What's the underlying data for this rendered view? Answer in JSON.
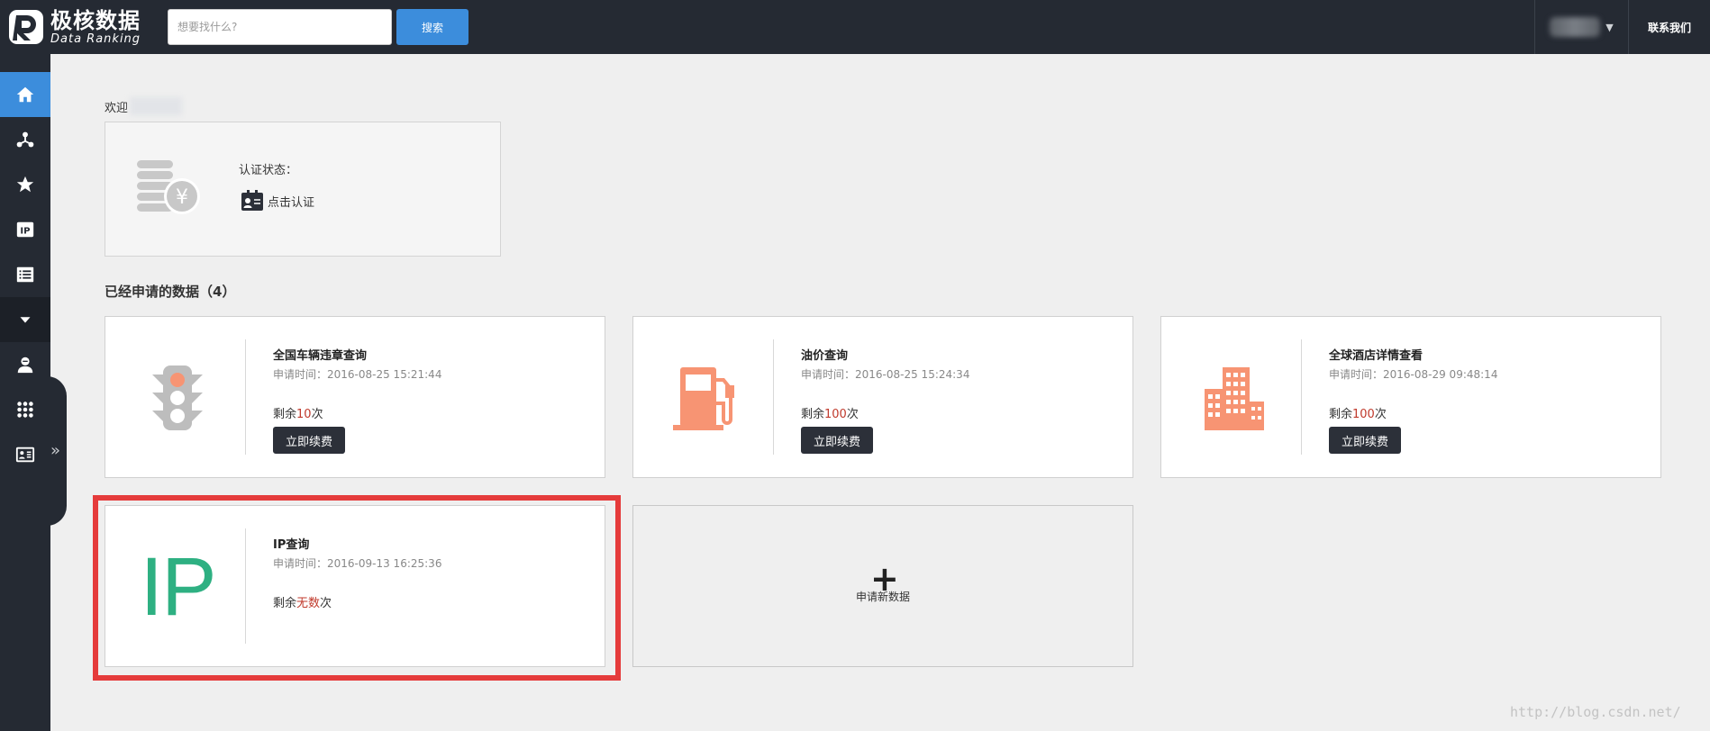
{
  "header": {
    "logo_cn": "极核数据",
    "logo_en": "Data Ranking",
    "search_placeholder": "想要找什么?",
    "search_button": "搜索",
    "contact": "联系我们"
  },
  "sidebar": {
    "items": [
      {
        "icon": "home-icon",
        "active": true
      },
      {
        "icon": "network-icon"
      },
      {
        "icon": "star-icon"
      },
      {
        "icon": "ip-icon",
        "label": "IP"
      },
      {
        "icon": "list-icon"
      },
      {
        "icon": "caret-down-icon"
      },
      {
        "icon": "user-icon"
      },
      {
        "icon": "apps-grid-icon"
      },
      {
        "icon": "id-card-icon"
      }
    ],
    "expand_label": "»"
  },
  "welcome": {
    "prefix": "欢迎"
  },
  "auth": {
    "title": "认证状态：",
    "link": "点击认证"
  },
  "section": {
    "title": "已经申请的数据（4）"
  },
  "cards": [
    {
      "name": "全国车辆违章查询",
      "time": "申请时间：2016-08-25 15:21:44",
      "remain_prefix": "剩余",
      "remain_num": "10",
      "remain_suffix": "次",
      "button": "立即续费",
      "icon": "traffic-light-icon"
    },
    {
      "name": "油价查询",
      "time": "申请时间：2016-08-25 15:24:34",
      "remain_prefix": "剩余",
      "remain_num": "100",
      "remain_suffix": "次",
      "button": "立即续费",
      "icon": "gas-pump-icon"
    },
    {
      "name": "全球酒店详情查看",
      "time": "申请时间：2016-08-29 09:48:14",
      "remain_prefix": "剩余",
      "remain_num": "100",
      "remain_suffix": "次",
      "button": "立即续费",
      "icon": "building-icon"
    },
    {
      "name": "IP查询",
      "time": "申请时间：2016-09-13 16:25:36",
      "remain_prefix": "剩余",
      "remain_num": "无数",
      "remain_suffix": "次",
      "logo_text": "IP",
      "icon": "ip-logo-icon"
    }
  ],
  "add_card": {
    "plus": "+",
    "label": "申请新数据"
  },
  "watermark": "http://blog.csdn.net/",
  "colors": {
    "topbar": "#252a33",
    "accent": "#3c8ddc",
    "highlight": "#e53b3b",
    "ip_green": "#2eb082",
    "salmon": "#f79473"
  }
}
